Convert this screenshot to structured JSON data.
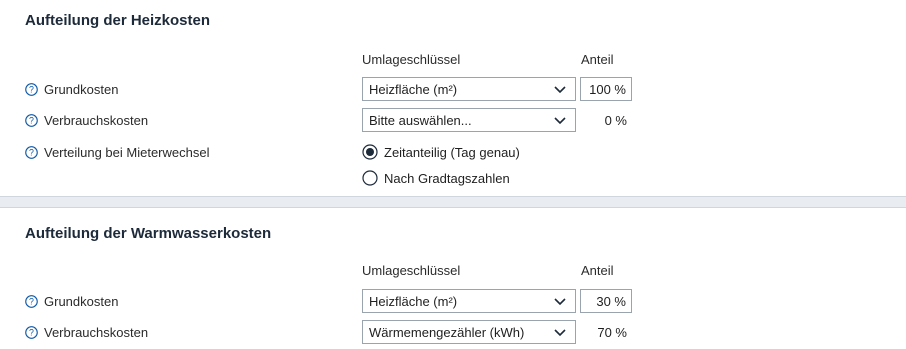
{
  "heizkosten": {
    "title": "Aufteilung der Heizkosten",
    "col_umlage": "Umlageschlüssel",
    "col_anteil": "Anteil",
    "grundkosten": {
      "label": "Grundkosten",
      "select_value": "Heizfläche (m²)",
      "anteil": "100 %"
    },
    "verbrauchskosten": {
      "label": "Verbrauchskosten",
      "select_value": "Bitte auswählen...",
      "anteil": "0 %"
    },
    "mieterwechsel": {
      "label": "Verteilung bei Mieterwechsel",
      "options": [
        {
          "label": "Zeitanteilig (Tag genau)",
          "selected": true
        },
        {
          "label": "Nach Gradtagszahlen",
          "selected": false
        }
      ]
    }
  },
  "warmwasserkosten": {
    "title": "Aufteilung der Warmwasserkosten",
    "col_umlage": "Umlageschlüssel",
    "col_anteil": "Anteil",
    "grundkosten": {
      "label": "Grundkosten",
      "select_value": "Heizfläche (m²)",
      "anteil": "30 %"
    },
    "verbrauchskosten": {
      "label": "Verbrauchskosten",
      "select_value": "Wärmemengezähler (kWh)",
      "anteil": "70 %"
    }
  },
  "colors": {
    "accent": "#0f5aa8",
    "divider": "#e9edf1",
    "border": "#9aa4ae"
  },
  "icons": {
    "help": "question-circle-icon",
    "dropdown": "chevron-down-icon",
    "radio": "radio-circle-icon"
  }
}
